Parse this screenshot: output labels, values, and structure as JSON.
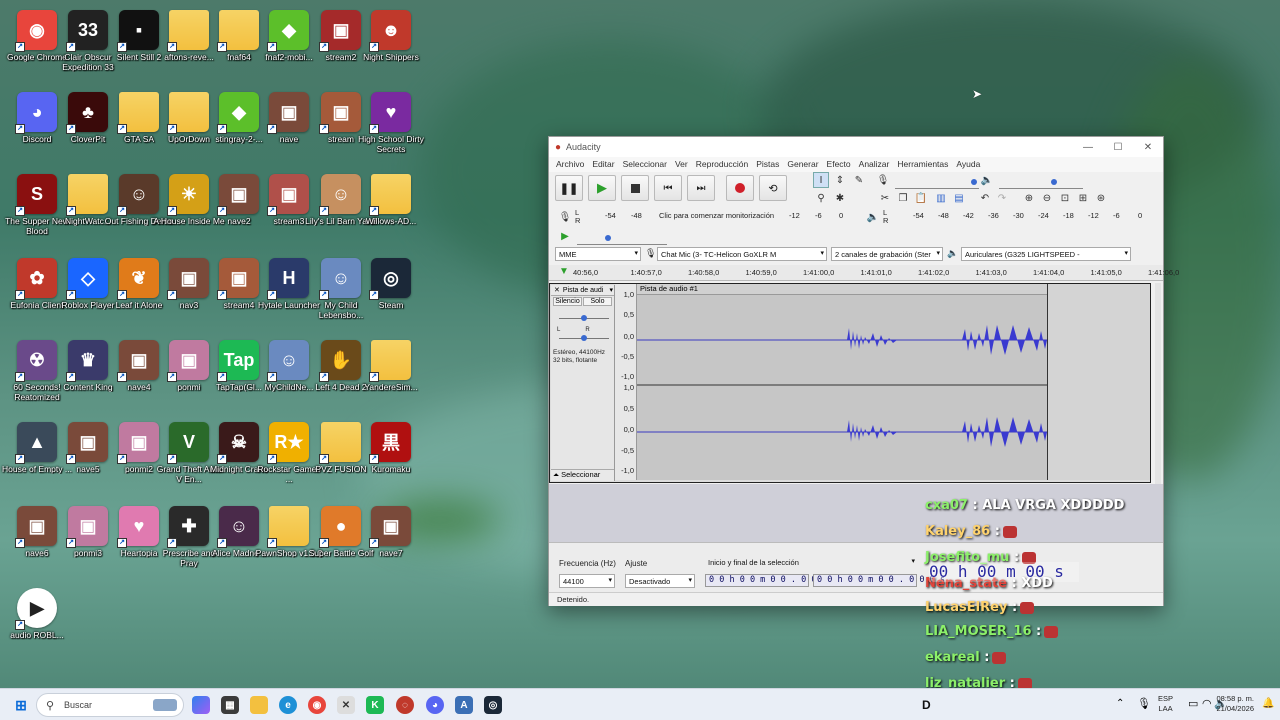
{
  "desktop": {
    "icons": [
      {
        "label": "Google Chrome",
        "glyph": "◉",
        "color": "#e8453c"
      },
      {
        "label": "Clair Obscur Expedition 33",
        "glyph": "33",
        "color": "#222"
      },
      {
        "label": "Silent Still 2",
        "glyph": "▪",
        "color": "#111"
      },
      {
        "label": "aftons-reve...",
        "glyph": "",
        "color": "#f3c03f"
      },
      {
        "label": "fnaf64",
        "glyph": "",
        "color": "#f3c03f"
      },
      {
        "label": "fnaf2-mobi...",
        "glyph": "◆",
        "color": "#5cbf2a"
      },
      {
        "label": "stream2",
        "glyph": "▣",
        "color": "#a52a2a"
      },
      {
        "label": "Night Shippers",
        "glyph": "☻",
        "color": "#c0392b"
      },
      {
        "label": "Discord",
        "glyph": "◕",
        "color": "#5865f2"
      },
      {
        "label": "CloverPit",
        "glyph": "♣",
        "color": "#3a0a0a"
      },
      {
        "label": "GTA SA",
        "glyph": "",
        "color": "#f3c03f"
      },
      {
        "label": "UpOrDown",
        "glyph": "",
        "color": "#f3c03f"
      },
      {
        "label": "stingray-2-...",
        "glyph": "◆",
        "color": "#5cbf2a"
      },
      {
        "label": "nave",
        "glyph": "▣",
        "color": "#7a4a3a"
      },
      {
        "label": "stream",
        "glyph": "▣",
        "color": "#a55a3a"
      },
      {
        "label": "High School Dirty Secrets",
        "glyph": "♥",
        "color": "#7a2aa0"
      },
      {
        "label": "The Supper New Blood",
        "glyph": "S",
        "color": "#8a1010"
      },
      {
        "label": "NightWatc...",
        "glyph": "",
        "color": "#f3c03f"
      },
      {
        "label": "Out Fishing Demo",
        "glyph": "☺",
        "color": "#5a3a2a"
      },
      {
        "label": "A House Inside Me",
        "glyph": "☀",
        "color": "#d4a017"
      },
      {
        "label": "nave2",
        "glyph": "▣",
        "color": "#7a4a3a"
      },
      {
        "label": "stream3",
        "glyph": "▣",
        "color": "#b0504a"
      },
      {
        "label": "Lily's Lil Barn Yard!",
        "glyph": "☺",
        "color": "#c69060"
      },
      {
        "label": "Willows-AD...",
        "glyph": "",
        "color": "#f3c03f"
      },
      {
        "label": "Eufonia Client",
        "glyph": "✿",
        "color": "#c0392b"
      },
      {
        "label": "Roblox Player",
        "glyph": "◇",
        "color": "#1a66ff"
      },
      {
        "label": "Leaf it Alone",
        "glyph": "❦",
        "color": "#e07b1a"
      },
      {
        "label": "nav3",
        "glyph": "▣",
        "color": "#7a4a3a"
      },
      {
        "label": "stream4",
        "glyph": "▣",
        "color": "#a55a3a"
      },
      {
        "label": "Hytale Launcher",
        "glyph": "H",
        "color": "#2a3a6a"
      },
      {
        "label": "My Child Lebensbo...",
        "glyph": "☺",
        "color": "#6a8ac0"
      },
      {
        "label": "Steam",
        "glyph": "◎",
        "color": "#1b2838"
      },
      {
        "label": "60 Seconds! Reatomized",
        "glyph": "☢",
        "color": "#6a4a8a"
      },
      {
        "label": "Content King",
        "glyph": "♛",
        "color": "#3a3a6a"
      },
      {
        "label": "nave4",
        "glyph": "▣",
        "color": "#7a4a3a"
      },
      {
        "label": "ponmi",
        "glyph": "▣",
        "color": "#c07aa0"
      },
      {
        "label": "TapTap(Gl...",
        "glyph": "Tap",
        "color": "#1db954"
      },
      {
        "label": "MyChildNe...",
        "glyph": "☺",
        "color": "#6a8ac0"
      },
      {
        "label": "Left 4 Dead 2",
        "glyph": "✋",
        "color": "#6a4a1a"
      },
      {
        "label": "YandereSim...",
        "glyph": "",
        "color": "#f3c03f"
      },
      {
        "label": "House of Empty ...",
        "glyph": "▲",
        "color": "#3a4a5a"
      },
      {
        "label": "nave5",
        "glyph": "▣",
        "color": "#7a4a3a"
      },
      {
        "label": "ponmi2",
        "glyph": "▣",
        "color": "#c07aa0"
      },
      {
        "label": "Grand Theft Auto V En...",
        "glyph": "V",
        "color": "#2a6a2a"
      },
      {
        "label": "Midnight Crane",
        "glyph": "☠",
        "color": "#3a1a1a"
      },
      {
        "label": "Rockstar Games ...",
        "glyph": "R★",
        "color": "#f0b000"
      },
      {
        "label": "PVZ FUSION",
        "glyph": "",
        "color": "#f3c03f"
      },
      {
        "label": "Kuromaku",
        "glyph": "黒",
        "color": "#b01010"
      },
      {
        "label": "nave6",
        "glyph": "▣",
        "color": "#7a4a3a"
      },
      {
        "label": "ponmi3",
        "glyph": "▣",
        "color": "#c07aa0"
      },
      {
        "label": "Heartopia",
        "glyph": "♥",
        "color": "#e07ab0"
      },
      {
        "label": "Prescribe and Pray",
        "glyph": "✚",
        "color": "#2a2a2a"
      },
      {
        "label": "Alice Madne...",
        "glyph": "☺",
        "color": "#4a2a4a"
      },
      {
        "label": "PawnShop v1.0.2",
        "glyph": "",
        "color": "#f3c03f"
      },
      {
        "label": "Super Battle Golf",
        "glyph": "●",
        "color": "#e07a2a"
      },
      {
        "label": "nave7",
        "glyph": "▣",
        "color": "#7a4a3a"
      },
      {
        "label": "audio ROBL...",
        "glyph": "▶",
        "color": "#ffffff"
      }
    ]
  },
  "audacity": {
    "title": "Audacity",
    "menu": [
      "Archivo",
      "Editar",
      "Seleccionar",
      "Ver",
      "Reproducción",
      "Pistas",
      "Generar",
      "Efecto",
      "Analizar",
      "Herramientas",
      "Ayuda"
    ],
    "monitor_hint": "Clic para comenzar monitorización",
    "meter_ticks_rec": [
      "-54",
      "-48",
      "-12",
      "-6",
      "0"
    ],
    "meter_ticks_play": [
      "-54",
      "-48",
      "-42",
      "-36",
      "-30",
      "-24",
      "-18",
      "-12",
      "-6",
      "0"
    ],
    "host": "MME",
    "rec_device": "Chat Mic (3- TC-Helicon GoXLR M",
    "channels": "2 canales de grabación (Ster",
    "play_device": "Auriculares (G325 LIGHTSPEED -",
    "ruler": [
      "40:56,0",
      "1:40:57,0",
      "1:40:58,0",
      "1:40:59,0",
      "1:41:00,0",
      "1:41:01,0",
      "1:41:02,0",
      "1:41:03,0",
      "1:41:04,0",
      "1:41:05,0",
      "1:41:06,0"
    ],
    "track": {
      "name": "Pista de audi",
      "clip_name": "Pista de audio #1",
      "mute": "Silencio",
      "solo": "Solo",
      "info1": "Estéreo, 44100Hz",
      "info2": "32 bits, flotante",
      "select": "Seleccionar",
      "scale": [
        "1,0",
        "0,5",
        "0,0",
        "-0,5",
        "-1,0",
        "1,0",
        "0,5",
        "0,0",
        "-0,5",
        "-1,0"
      ]
    },
    "selection_bar": {
      "rate_label": "Frecuencia (Hz)",
      "rate_value": "44100",
      "snap_label": "Ajuste",
      "snap_value": "Desactivado",
      "mode": "Inicio y final de la selección",
      "time1": "0 0 h 0 0 m 0 0 . 0 0 0 s",
      "time2": "0 0 h 0 0 m 0 0 . 0 0 0 s"
    },
    "status": "Detenido."
  },
  "chat": [
    {
      "user": "cxa07",
      "text": ": ALA VRGA XDDDDD",
      "ucolor": "green"
    },
    {
      "user": "Kaley_86",
      "text": ":",
      "ucolor": "yellow"
    },
    {
      "user": "Josefito_mu",
      "text": ":",
      "ucolor": "green"
    },
    {
      "user": "Nena_state",
      "text": ": XDD",
      "ucolor": "red"
    },
    {
      "user": "LucasElRey",
      "text": ":",
      "ucolor": "yellow"
    },
    {
      "user": "LIA_MOSER_16",
      "text": ":",
      "ucolor": "green"
    },
    {
      "user": "ekareal",
      "text": ":",
      "ucolor": "green"
    },
    {
      "user": "liz_natalier",
      "text": ":",
      "ucolor": "green"
    }
  ],
  "overlay_time": "00 h 00 m 00 s",
  "taskbar": {
    "search_placeholder": "Buscar",
    "lang1": "ESP",
    "lang2": "LAA",
    "time": "08:58 p. m.",
    "date": "21/04/2026",
    "tray_letter": "D"
  }
}
